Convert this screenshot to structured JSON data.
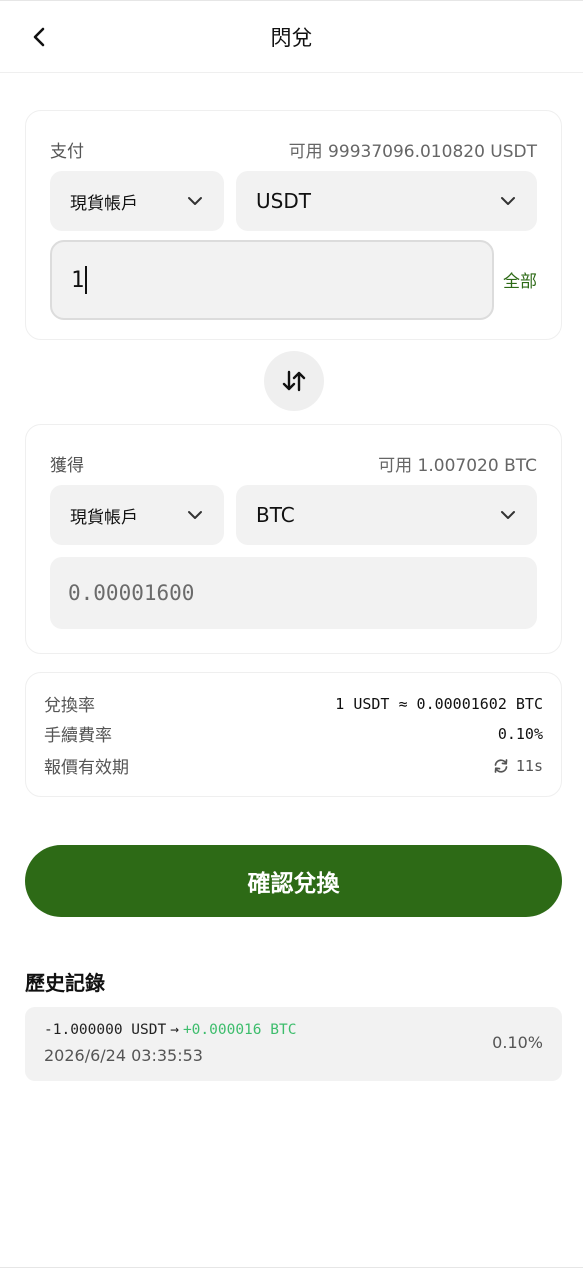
{
  "header": {
    "title": "閃兌"
  },
  "pay": {
    "label": "支付",
    "available": "可用 99937096.010820 USDT",
    "account": "現貨帳戶",
    "currency": "USDT",
    "amount": "1",
    "all_label": "全部"
  },
  "receive": {
    "label": "獲得",
    "available": "可用 1.007020 BTC",
    "account": "現貨帳戶",
    "currency": "BTC",
    "amount": "0.00001600"
  },
  "info": {
    "rate_label": "兌換率",
    "rate_value": "1 USDT ≈ 0.00001602 BTC",
    "fee_label": "手續費率",
    "fee_value": "0.10%",
    "validity_label": "報價有效期",
    "validity_value": "11s"
  },
  "confirm_label": "確認兌換",
  "history": {
    "title": "歷史記錄",
    "items": [
      {
        "from": "-1.000000 USDT",
        "arrow": "→",
        "to": "+0.000016 BTC",
        "time": "2026/6/24 03:35:53",
        "fee": "0.10%"
      }
    ]
  },
  "colors": {
    "accent": "#2d6a16",
    "positive": "#3dbd6c"
  }
}
